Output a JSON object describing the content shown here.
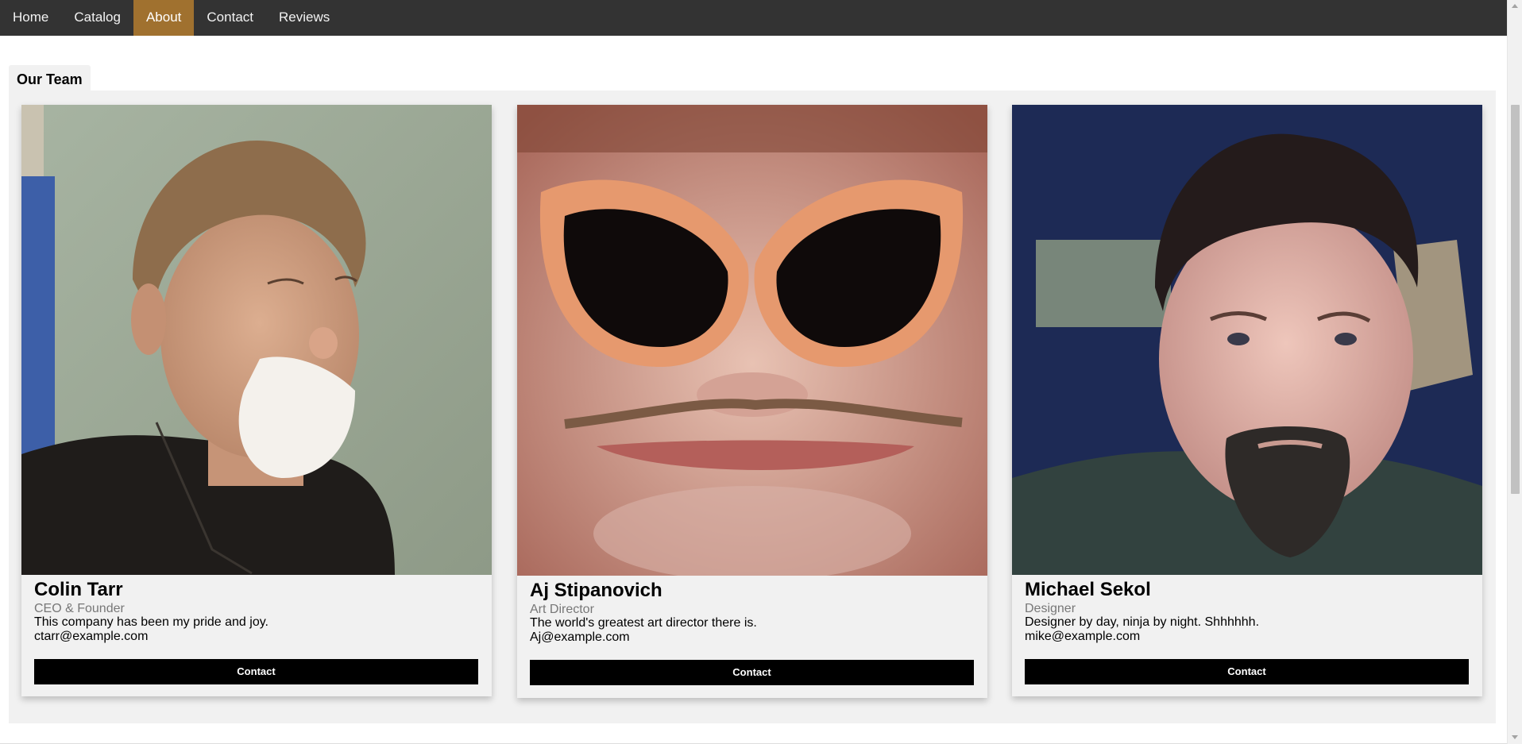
{
  "nav": {
    "items": [
      {
        "label": "Home",
        "active": false
      },
      {
        "label": "Catalog",
        "active": false
      },
      {
        "label": "About",
        "active": true
      },
      {
        "label": "Contact",
        "active": false
      },
      {
        "label": "Reviews",
        "active": false
      }
    ]
  },
  "colors": {
    "nav_bg": "#333333",
    "nav_active": "#a0712f",
    "panel_bg": "#f1f1f1",
    "button_bg": "#000000"
  },
  "team_tab": {
    "label": "Our Team"
  },
  "team": [
    {
      "name": "Colin Tarr",
      "title": "CEO & Founder",
      "description": "This company has been my pride and joy.",
      "email": "ctarr@example.com",
      "button": "Contact",
      "photo_desc": "Young man with a whipped-cream beard wearing a dark shirt and necklace against a pale green wall"
    },
    {
      "name": "Aj Stipanovich",
      "title": "Art Director",
      "description": "The world's greatest art director there is.",
      "email": "Aj@example.com",
      "button": "Contact",
      "photo_desc": "Close-up face with large orange sunglasses and a thin mustache"
    },
    {
      "name": "Michael Sekol",
      "title": "Designer",
      "description": "Designer by day, ninja by night. Shhhhhh.",
      "email": "mike@example.com",
      "button": "Contact",
      "photo_desc": "Man with curly dark hair and goatee in a green sweater in front of a dark blue wall"
    }
  ]
}
